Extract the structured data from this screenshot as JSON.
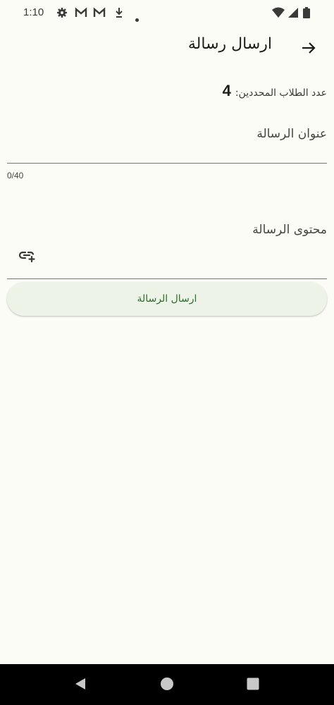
{
  "status_bar": {
    "time": "1:10",
    "icons": [
      "gear-icon",
      "gmail-icon",
      "gmail-icon",
      "download-icon",
      "dot-icon",
      "wifi-icon",
      "signal-icon",
      "battery-icon"
    ]
  },
  "app_bar": {
    "title": "ارسال رسالة",
    "back_icon": "arrow-right-icon"
  },
  "selected_students": {
    "label": "عدد الطلاب المحددين:",
    "count": "4"
  },
  "subject_field": {
    "label": "عنوان الرسالة",
    "value": "",
    "counter": "0/40"
  },
  "content_field": {
    "label": "محتوى الرسالة",
    "value": "",
    "attach_icon": "add-link-icon"
  },
  "send_button": {
    "label": "ارسال الرسالة"
  },
  "nav_bar": {
    "icons": [
      "back-triangle-icon",
      "home-circle-icon",
      "recents-square-icon"
    ]
  },
  "colors": {
    "background": "#fcfcf6",
    "accent": "#2e6b2e",
    "button_bg": "#eef3e8"
  }
}
